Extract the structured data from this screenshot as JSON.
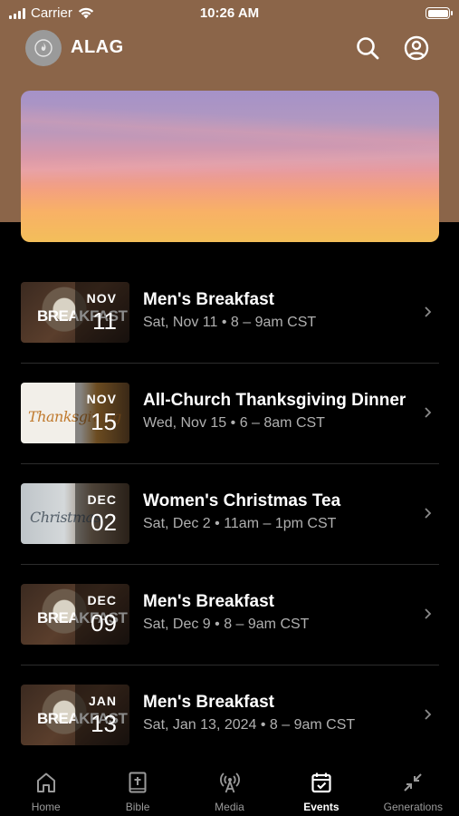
{
  "status_bar": {
    "carrier": "Carrier",
    "time": "10:26 AM"
  },
  "header": {
    "app_name": "ALAG",
    "logo_icon": "flame-icon",
    "search_icon": "search-icon",
    "profile_icon": "profile-icon",
    "accent_color": "#8b6549"
  },
  "events": [
    {
      "title": "Men's Breakfast",
      "meta": "Sat, Nov 11 • 8 – 9am CST",
      "month": "NOV",
      "day": "11",
      "thumb_text": "BREAKFAST"
    },
    {
      "title": "All-Church Thanksgiving Dinner",
      "meta": "Wed, Nov 15 • 6 – 8am CST",
      "month": "NOV",
      "day": "15",
      "thumb_text": "Thanksgiving"
    },
    {
      "title": "Women's Christmas Tea",
      "meta": "Sat, Dec 2 • 11am – 1pm CST",
      "month": "DEC",
      "day": "02",
      "thumb_text": "Christmas"
    },
    {
      "title": "Men's Breakfast",
      "meta": "Sat, Dec 9 • 8 – 9am CST",
      "month": "DEC",
      "day": "09",
      "thumb_text": "BREAKFAST"
    },
    {
      "title": "Men's Breakfast",
      "meta": "Sat, Jan 13, 2024 • 8 – 9am CST",
      "month": "JAN",
      "day": "13",
      "thumb_text": "BREAKFAST"
    }
  ],
  "tabs": [
    {
      "label": "Home",
      "icon": "home-icon"
    },
    {
      "label": "Bible",
      "icon": "bible-icon"
    },
    {
      "label": "Media",
      "icon": "broadcast-icon"
    },
    {
      "label": "Events",
      "icon": "calendar-icon",
      "active": true
    },
    {
      "label": "Generations",
      "icon": "collapse-arrows-icon"
    }
  ]
}
